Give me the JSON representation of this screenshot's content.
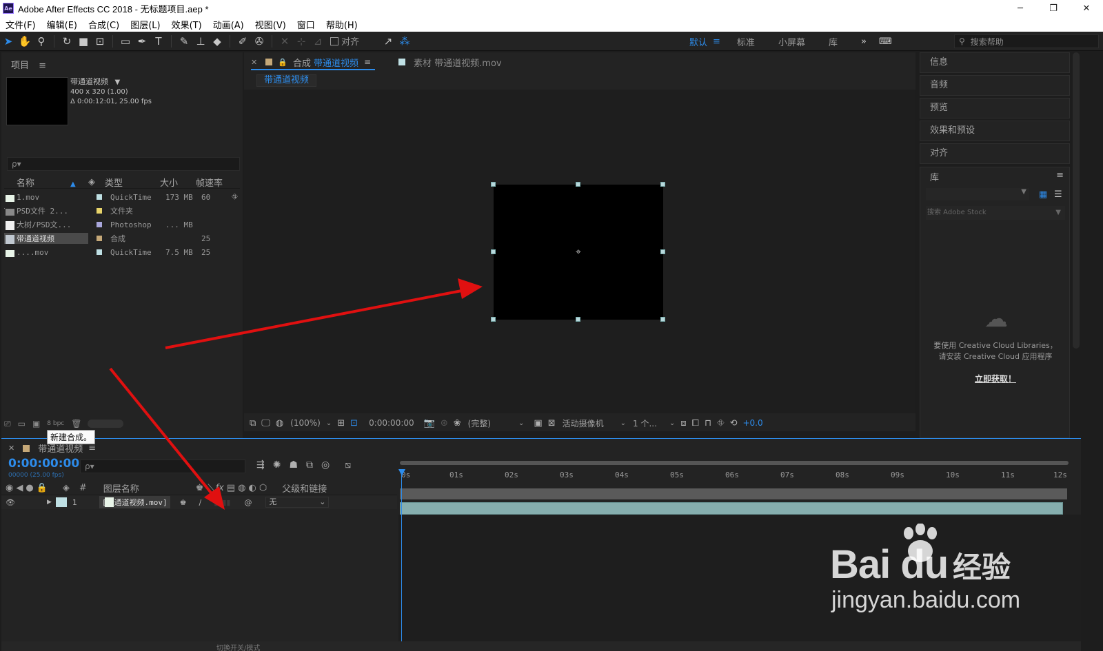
{
  "window": {
    "title": "Adobe After Effects CC 2018 - 无标题项目.aep *",
    "app_icon_text": "Ae",
    "minimize": "─",
    "restore": "❐",
    "close": "✕"
  },
  "menu": [
    "文件(F)",
    "编辑(E)",
    "合成(C)",
    "图层(L)",
    "效果(T)",
    "动画(A)",
    "视图(V)",
    "窗口",
    "帮助(H)"
  ],
  "toolbar": {
    "align_label": "对齐",
    "workspaces": [
      "默认",
      "标准",
      "小屏幕",
      "库"
    ],
    "more": "»",
    "help_search_placeholder": "搜索帮助"
  },
  "project": {
    "tab_label": "项目",
    "menu_glyph": "≡",
    "selected": {
      "name": "带通道视频",
      "dims": "400 x 320 (1.00)",
      "duration": "Δ 0:00:12:01, 25.00 fps"
    },
    "search_glyph": "ρ▾",
    "columns": {
      "name": "名称",
      "type": "类型",
      "size": "大小",
      "fps": "帧速率"
    },
    "items": [
      {
        "name": "1.mov",
        "type": "QuickTime",
        "size": "173 MB",
        "fps": "60",
        "color": "#bfe0e4"
      },
      {
        "name": "PSD文件 2...",
        "type": "文件夹",
        "size": "",
        "fps": "",
        "color": "#e8d46a"
      },
      {
        "name": "大树/PSD文...",
        "type": "Photoshop",
        "size": "... MB",
        "fps": "",
        "color": "#a9a7dc"
      },
      {
        "name": "带通道视频",
        "type": "合成",
        "size": "",
        "fps": "25",
        "color": "#c5a878"
      },
      {
        "name": "....mov",
        "type": "QuickTime",
        "size": "7.5 MB",
        "fps": "25",
        "color": "#bfe0e4"
      }
    ],
    "bpc": "8 bpc",
    "tooltip": "新建合成。"
  },
  "comp": {
    "tab_prefix": "合成",
    "tab_name": "带通道视频",
    "footage_tab": "素材 带通道视频.mov",
    "breadcrumb": "带通道视频",
    "zoom": "(100%)",
    "timecode": "0:00:00:00",
    "resolution": "(完整)",
    "camera": "活动摄像机",
    "views": "1 个...",
    "exposure": "+0.0"
  },
  "right_panels": [
    "信息",
    "音频",
    "预览",
    "效果和预设",
    "对齐"
  ],
  "library": {
    "title": "库",
    "stock_placeholder": "搜索 Adobe Stock",
    "message_line1": "要使用 Creative Cloud Libraries，",
    "message_line2": "请安装 Creative Cloud 应用程序",
    "get_now": "立即获取！"
  },
  "timeline": {
    "tab_name": "带通道视频",
    "timecode": "0:00:00:00",
    "timecode_sub": "00000 (25.00 fps)",
    "columns": {
      "num": "#",
      "layer_name": "图层名称",
      "parent": "父级和链接"
    },
    "layer": {
      "index": "1",
      "name": "[带通道视频.mov]",
      "parent": "无"
    },
    "ruler_labels": [
      "0s",
      "01s",
      "02s",
      "03s",
      "04s",
      "05s",
      "06s",
      "07s",
      "08s",
      "09s",
      "10s",
      "11s",
      "12s"
    ],
    "bottom_text": "切换开关/模式"
  },
  "watermark": {
    "logo": "Bai du",
    "logo_cn": "经验",
    "url": "jingyan.baidu.com"
  },
  "colors": {
    "accent": "#2d8ceb",
    "panel": "#232323",
    "annotation_arrow": "#e01010"
  }
}
